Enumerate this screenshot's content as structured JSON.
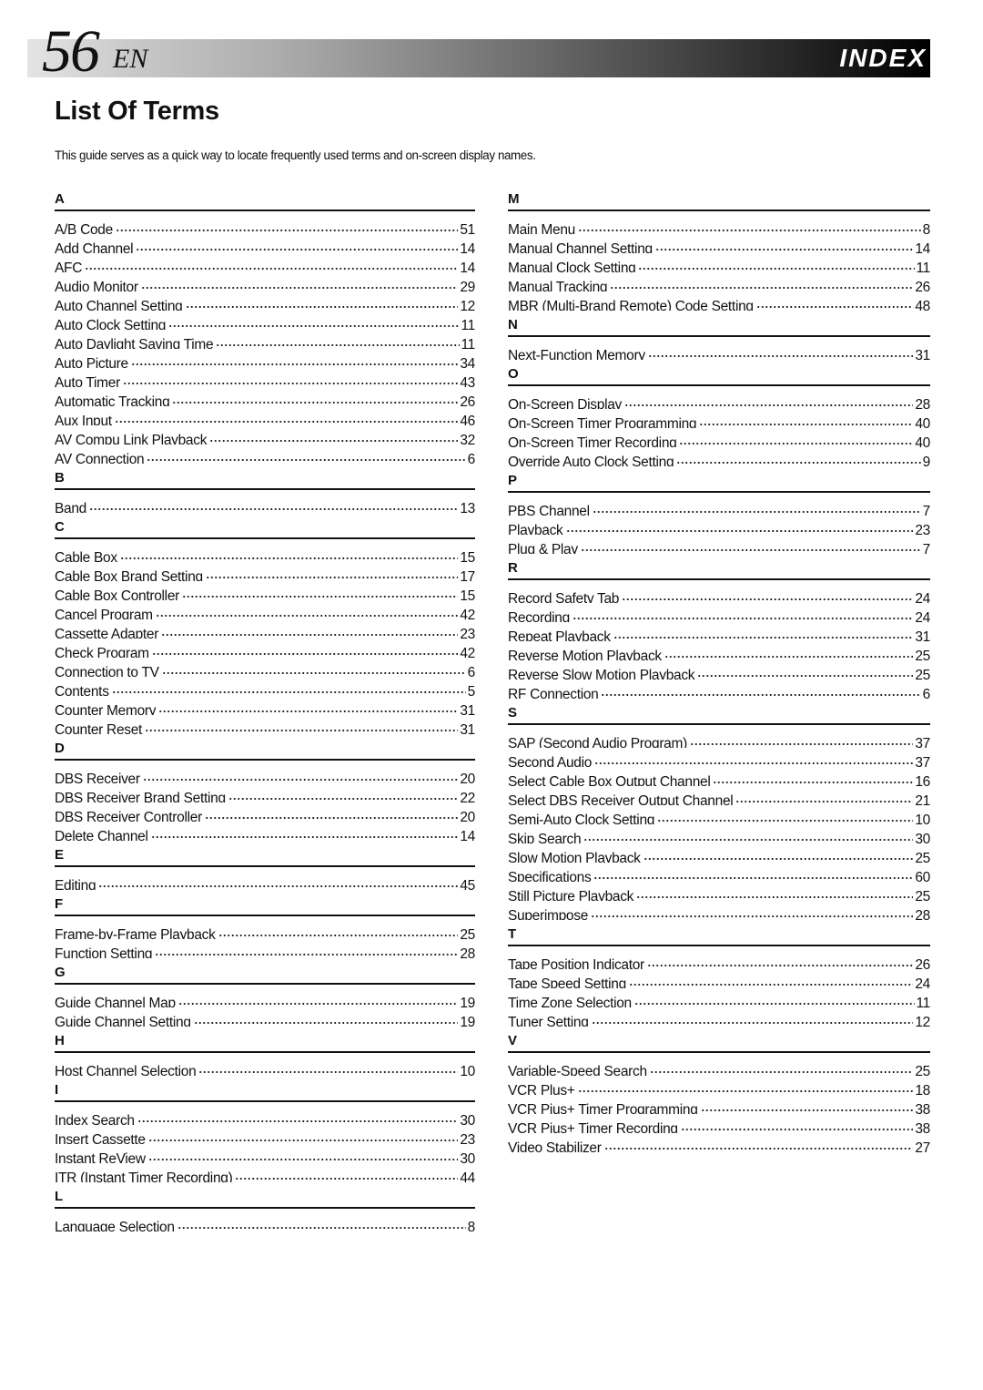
{
  "header": {
    "page_number": "56",
    "language": "EN",
    "section": "INDEX"
  },
  "title": "List Of Terms",
  "intro": "This guide serves as a quick way to locate frequently used terms and on-screen display names.",
  "columns": [
    {
      "sections": [
        {
          "letter": "A",
          "entries": [
            {
              "term": "A/B Code",
              "page": "51"
            },
            {
              "term": "Add Channel",
              "page": "14"
            },
            {
              "term": "AFC",
              "page": "14"
            },
            {
              "term": "Audio Monitor",
              "page": "29"
            },
            {
              "term": "Auto Channel Setting",
              "page": "12"
            },
            {
              "term": "Auto Clock Setting",
              "page": "11"
            },
            {
              "term": "Auto Daylight Saving Time",
              "page": "11"
            },
            {
              "term": "Auto Picture",
              "page": "34"
            },
            {
              "term": "Auto Timer",
              "page": "43"
            },
            {
              "term": "Automatic Tracking",
              "page": "26"
            },
            {
              "term": "Aux Input",
              "page": "46"
            },
            {
              "term": "AV Compu Link Playback",
              "page": "32"
            },
            {
              "term": "AV Connection",
              "page": "6"
            }
          ]
        },
        {
          "letter": "B",
          "entries": [
            {
              "term": "Band",
              "page": "13"
            }
          ]
        },
        {
          "letter": "C",
          "entries": [
            {
              "term": "Cable Box",
              "page": "15"
            },
            {
              "term": "Cable Box Brand Setting",
              "page": "17"
            },
            {
              "term": "Cable Box Controller",
              "page": "15"
            },
            {
              "term": "Cancel Program",
              "page": "42"
            },
            {
              "term": "Cassette Adapter",
              "page": "23"
            },
            {
              "term": "Check Program",
              "page": "42"
            },
            {
              "term": "Connection to TV",
              "page": "6"
            },
            {
              "term": "Contents",
              "page": "5"
            },
            {
              "term": "Counter Memory",
              "page": "31"
            },
            {
              "term": "Counter Reset",
              "page": "31"
            }
          ]
        },
        {
          "letter": "D",
          "entries": [
            {
              "term": "DBS Receiver",
              "page": "20"
            },
            {
              "term": "DBS Receiver Brand Setting",
              "page": "22"
            },
            {
              "term": "DBS Receiver Controller",
              "page": "20"
            },
            {
              "term": "Delete Channel",
              "page": "14"
            }
          ]
        },
        {
          "letter": "E",
          "entries": [
            {
              "term": "Editing",
              "page": "45"
            }
          ]
        },
        {
          "letter": "F",
          "entries": [
            {
              "term": "Frame-by-Frame Playback",
              "page": "25"
            },
            {
              "term": "Function Setting",
              "page": "28"
            }
          ]
        },
        {
          "letter": "G",
          "entries": [
            {
              "term": "Guide Channel Map",
              "page": "19"
            },
            {
              "term": "Guide Channel Setting",
              "page": "19"
            }
          ]
        },
        {
          "letter": "H",
          "entries": [
            {
              "term": "Host Channel Selection",
              "page": "10"
            }
          ]
        },
        {
          "letter": "I",
          "entries": [
            {
              "term": "Index Search",
              "page": "30"
            },
            {
              "term": "Insert Cassette",
              "page": "23"
            },
            {
              "term": "Instant ReView",
              "page": "30"
            },
            {
              "term": "ITR (Instant Timer Recording)",
              "page": "44"
            }
          ]
        },
        {
          "letter": "L",
          "entries": [
            {
              "term": "Language Selection",
              "page": "8"
            }
          ]
        }
      ]
    },
    {
      "sections": [
        {
          "letter": "M",
          "entries": [
            {
              "term": "Main Menu",
              "page": "8"
            },
            {
              "term": "Manual Channel Setting",
              "page": "14"
            },
            {
              "term": "Manual Clock Setting",
              "page": "11"
            },
            {
              "term": "Manual Tracking",
              "page": "26"
            },
            {
              "term": "MBR (Multi-Brand Remote) Code Setting",
              "page": "48"
            }
          ]
        },
        {
          "letter": "N",
          "entries": [
            {
              "term": "Next-Function Memory",
              "page": "31"
            }
          ]
        },
        {
          "letter": "O",
          "entries": [
            {
              "term": "On-Screen Display",
              "page": "28"
            },
            {
              "term": "On-Screen Timer Programming",
              "page": "40"
            },
            {
              "term": "On-Screen Timer Recording",
              "page": "40"
            },
            {
              "term": "Override Auto Clock Setting",
              "page": "9"
            }
          ]
        },
        {
          "letter": "P",
          "entries": [
            {
              "term": "PBS Channel",
              "page": "7"
            },
            {
              "term": "Playback",
              "page": "23"
            },
            {
              "term": "Plug & Play",
              "page": "7"
            }
          ]
        },
        {
          "letter": "R",
          "entries": [
            {
              "term": "Record Safety Tab",
              "page": "24"
            },
            {
              "term": "Recording",
              "page": "24"
            },
            {
              "term": "Repeat Playback",
              "page": "31"
            },
            {
              "term": "Reverse Motion Playback",
              "page": "25"
            },
            {
              "term": "Reverse Slow Motion Playback",
              "page": "25"
            },
            {
              "term": "RF Connection",
              "page": "6"
            }
          ]
        },
        {
          "letter": "S",
          "entries": [
            {
              "term": "SAP (Second Audio Program)",
              "page": "37"
            },
            {
              "term": "Second Audio",
              "page": "37"
            },
            {
              "term": "Select Cable Box Output Channel",
              "page": "16"
            },
            {
              "term": "Select DBS Receiver Output Channel",
              "page": "21"
            },
            {
              "term": "Semi-Auto Clock Setting",
              "page": "10"
            },
            {
              "term": "Skip Search",
              "page": "30"
            },
            {
              "term": "Slow Motion Playback",
              "page": "25"
            },
            {
              "term": "Specifications",
              "page": "60"
            },
            {
              "term": "Still Picture Playback",
              "page": "25"
            },
            {
              "term": "Superimpose",
              "page": "28"
            }
          ]
        },
        {
          "letter": "T",
          "entries": [
            {
              "term": "Tape Position Indicator",
              "page": "26"
            },
            {
              "term": "Tape Speed Setting",
              "page": "24"
            },
            {
              "term": "Time Zone Selection",
              "page": "11"
            },
            {
              "term": "Tuner Setting",
              "page": "12"
            }
          ]
        },
        {
          "letter": "V",
          "entries": [
            {
              "term": "Variable-Speed Search",
              "page": "25"
            },
            {
              "term": "VCR Plus+",
              "page": "18"
            },
            {
              "term": "VCR Pius+ Timer Programming",
              "page": "38"
            },
            {
              "term": "VCR Pius+ Timer Recording",
              "page": "38"
            },
            {
              "term": "Video Stabilizer",
              "page": "27"
            }
          ]
        }
      ]
    }
  ]
}
